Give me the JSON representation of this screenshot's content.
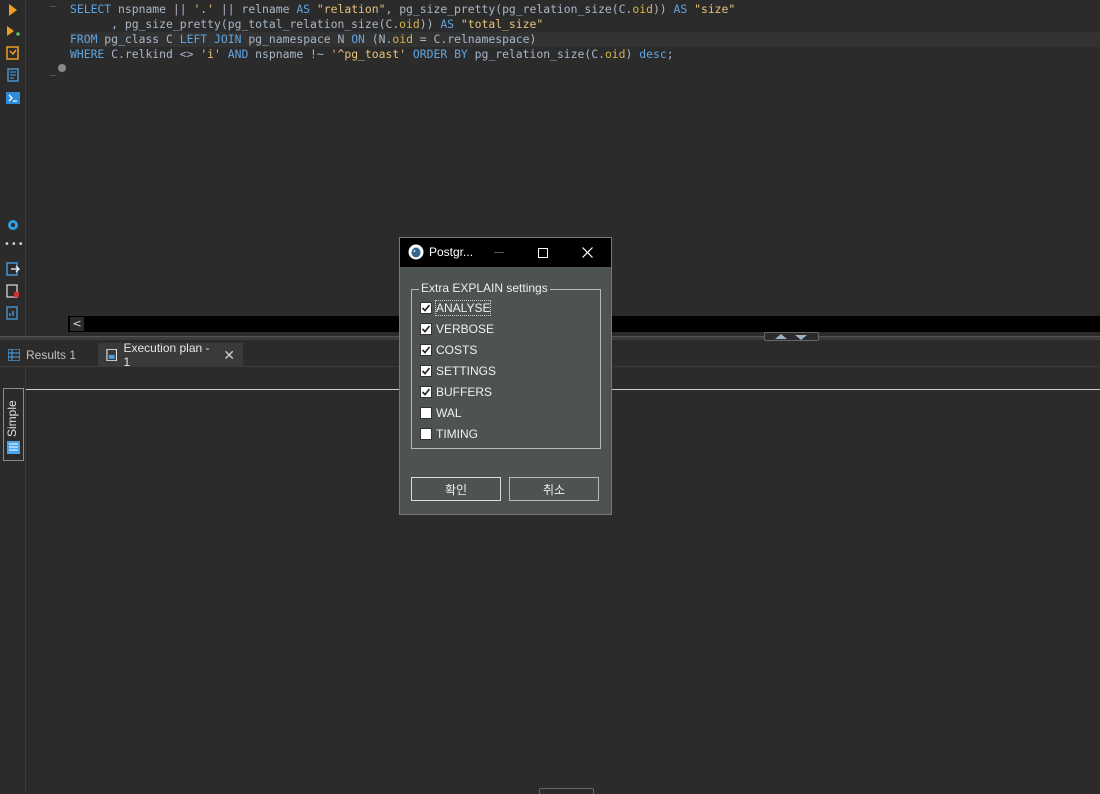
{
  "editor": {
    "lines": [
      [
        {
          "t": "SELECT",
          "c": "kw"
        },
        {
          "t": " nspname || ",
          "c": ""
        },
        {
          "t": "'.'",
          "c": "str"
        },
        {
          "t": " || relname ",
          "c": ""
        },
        {
          "t": "AS",
          "c": "kw"
        },
        {
          "t": " ",
          "c": ""
        },
        {
          "t": "\"relation\"",
          "c": "str"
        },
        {
          "t": ", pg_size_pretty(pg_relation_size(C.",
          "c": ""
        },
        {
          "t": "oid",
          "c": "col"
        },
        {
          "t": ")) ",
          "c": ""
        },
        {
          "t": "AS",
          "c": "kw"
        },
        {
          "t": " ",
          "c": ""
        },
        {
          "t": "\"size\"",
          "c": "str"
        }
      ],
      [
        {
          "t": "      , pg_size_pretty(pg_total_relation_size(C.",
          "c": ""
        },
        {
          "t": "oid",
          "c": "col"
        },
        {
          "t": ")) ",
          "c": ""
        },
        {
          "t": "AS",
          "c": "kw"
        },
        {
          "t": " ",
          "c": ""
        },
        {
          "t": "\"total_size\"",
          "c": "str"
        }
      ],
      [
        {
          "t": "FROM",
          "c": "kw"
        },
        {
          "t": " pg_class C ",
          "c": ""
        },
        {
          "t": "LEFT JOIN",
          "c": "kw"
        },
        {
          "t": " pg_namespace N ",
          "c": ""
        },
        {
          "t": "ON",
          "c": "kw"
        },
        {
          "t": " (N.",
          "c": ""
        },
        {
          "t": "oid",
          "c": "col"
        },
        {
          "t": " = C.relnamespace)",
          "c": ""
        }
      ],
      [
        {
          "t": "WHERE",
          "c": "kw"
        },
        {
          "t": " C.relkind <> ",
          "c": ""
        },
        {
          "t": "'i'",
          "c": "str"
        },
        {
          "t": " ",
          "c": ""
        },
        {
          "t": "AND",
          "c": "kw"
        },
        {
          "t": " nspname !~ ",
          "c": ""
        },
        {
          "t": "'^pg_toast'",
          "c": "str"
        },
        {
          "t": " ",
          "c": ""
        },
        {
          "t": "ORDER BY",
          "c": "kw"
        },
        {
          "t": " pg_relation_size(C.",
          "c": ""
        },
        {
          "t": "oid",
          "c": "col"
        },
        {
          "t": ") ",
          "c": ""
        },
        {
          "t": "desc",
          "c": "kw"
        },
        {
          "t": ";",
          "c": ""
        }
      ]
    ]
  },
  "results_tabs": [
    {
      "label": "Results 1",
      "active": false
    },
    {
      "label": "Execution plan - 1",
      "active": true
    }
  ],
  "plan_panel": {
    "mode_label": "Simple"
  },
  "dialog": {
    "title": "Postgr...",
    "group_label": "Extra EXPLAIN settings",
    "options": [
      {
        "label": "ANALYSE",
        "checked": true,
        "focused": true
      },
      {
        "label": "VERBOSE",
        "checked": true
      },
      {
        "label": "COSTS",
        "checked": true
      },
      {
        "label": "SETTINGS",
        "checked": true
      },
      {
        "label": "BUFFERS",
        "checked": true
      },
      {
        "label": "WAL",
        "checked": false
      },
      {
        "label": "TIMING",
        "checked": false
      }
    ],
    "ok_label": "확인",
    "cancel_label": "취소"
  },
  "colors": {
    "background": "#2b2b2b",
    "keyword": "#5fa4e0",
    "string": "#e6c27a",
    "dialog_bg": "#4d5252"
  }
}
